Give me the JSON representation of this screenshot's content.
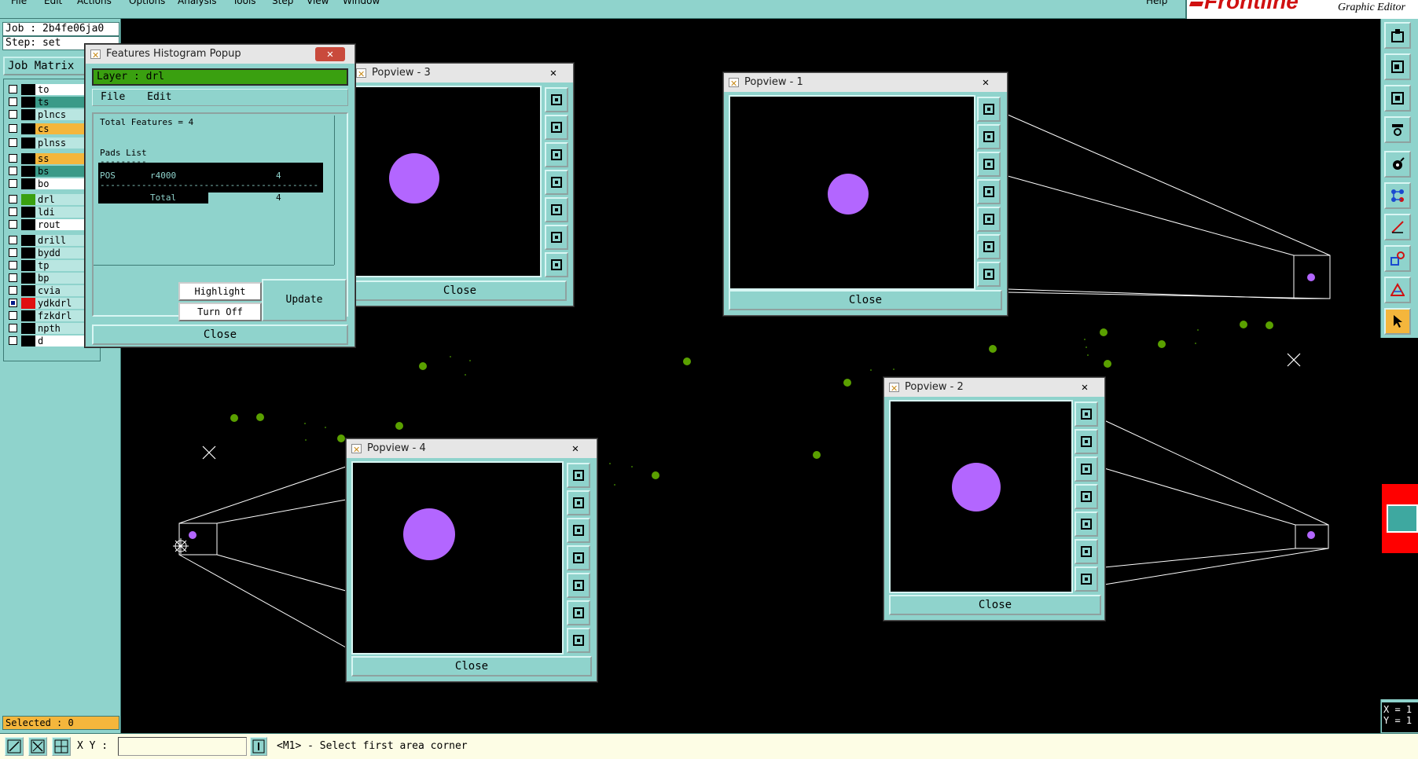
{
  "menubar": {
    "items": [
      "File",
      "Edit",
      "Actions",
      "Options",
      "Analysis",
      "Tools",
      "Step",
      "View",
      "Window"
    ],
    "help": "Help",
    "logo_text": "Frontline",
    "app_title": "Graphic Editor"
  },
  "left": {
    "job": "Job : 2b4fe06ja0",
    "step": "Step: set",
    "job_matrix": "Job Matrix",
    "layers": [
      {
        "name": "to",
        "color": "#ffffff",
        "checked": false,
        "swatch": "black"
      },
      {
        "name": "ts",
        "color": "#3a9a88",
        "checked": false,
        "swatch": "black"
      },
      {
        "name": "plncs",
        "color": "#b9e6e1",
        "checked": false,
        "swatch": "black"
      },
      {
        "name": "cs",
        "color": "#f4b63c",
        "checked": false,
        "swatch": "black"
      },
      {
        "name": "plnss",
        "color": "#b9e6e1",
        "checked": false,
        "swatch": "black"
      },
      {
        "name": "ss",
        "color": "#f4b63c",
        "checked": false,
        "swatch": "black"
      },
      {
        "name": "bs",
        "color": "#3a9a88",
        "checked": false,
        "swatch": "black"
      },
      {
        "name": "bo",
        "color": "#ffffff",
        "checked": false,
        "swatch": "black"
      },
      {
        "name": "drl",
        "color": "#b9e6e1",
        "checked": false,
        "swatch": "green"
      },
      {
        "name": "ldi",
        "color": "#b9e6e1",
        "checked": false,
        "swatch": "black"
      },
      {
        "name": "rout",
        "color": "#ffffff",
        "checked": false,
        "swatch": "black"
      },
      {
        "name": "drill",
        "color": "#b9e6e1",
        "checked": false,
        "swatch": "black"
      },
      {
        "name": "bydd",
        "color": "#b9e6e1",
        "checked": false,
        "swatch": "black"
      },
      {
        "name": "tp",
        "color": "#b9e6e1",
        "checked": false,
        "swatch": "black"
      },
      {
        "name": "bp",
        "color": "#b9e6e1",
        "checked": false,
        "swatch": "black"
      },
      {
        "name": "cvia",
        "color": "#b9e6e1",
        "checked": false,
        "swatch": "black"
      },
      {
        "name": "ydkdrl",
        "color": "#b9e6e1",
        "checked": true,
        "swatch": "red"
      },
      {
        "name": "fzkdrl",
        "color": "#b9e6e1",
        "checked": false,
        "swatch": "black"
      },
      {
        "name": "npth",
        "color": "#b9e6e1",
        "checked": false,
        "swatch": "black"
      },
      {
        "name": "d",
        "color": "#ffffff",
        "checked": false,
        "swatch": "black"
      }
    ],
    "selected": "Selected : 0"
  },
  "status": {
    "xy_label": "X Y :",
    "xy_value": "",
    "message": "<M1> - Select first area corner",
    "readout_x": "X = 1",
    "readout_y": "Y = 1"
  },
  "histogram": {
    "title": "Features Histogram Popup",
    "layer": "Layer :  drl",
    "menu_file": "File",
    "menu_edit": "Edit",
    "total": "Total Features = 4",
    "section": "Pads List",
    "underline": "---------",
    "row_pos": "POS",
    "row_sym": "r4000",
    "row_count": "4",
    "dashes": "----------------------------------------------",
    "total_label": "Total",
    "total_count": "4",
    "highlight": "Highlight",
    "turn_off": "Turn Off",
    "update": "Update",
    "close": "Close"
  },
  "popviews": [
    {
      "title": "Popview - 3",
      "close": "Close"
    },
    {
      "title": "Popview - 1",
      "close": "Close"
    },
    {
      "title": "Popview - 2",
      "close": "Close"
    },
    {
      "title": "Popview - 4",
      "close": "Close"
    }
  ],
  "colors": {
    "ui_teal": "#8fd3cc",
    "pad_purple": "#b366ff",
    "via_green": "#5aa000",
    "layer_green": "#3aa010",
    "accent_orange": "#f4b63c"
  }
}
